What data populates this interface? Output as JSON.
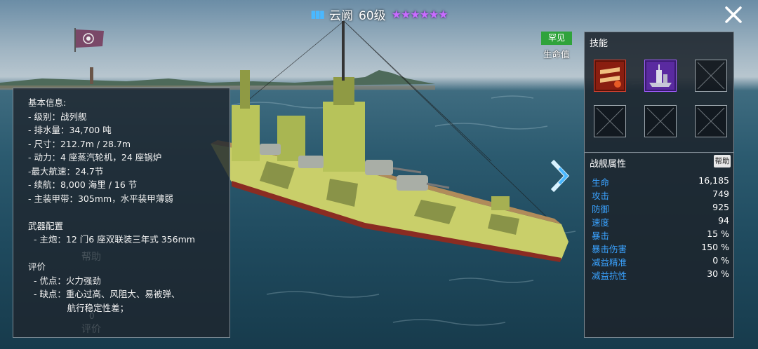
{
  "header": {
    "ammo_icon": "ammo-icon",
    "ship_name": "云阙",
    "level": "60级",
    "stars": 6,
    "star_color": "#c86cff"
  },
  "ship_info": {
    "lines": [
      "基本信息:",
      "- 级别：战列舰",
      "- 排水量：34,700 吨",
      "- 尺寸：212.7m / 28.7m",
      "- 动力：4 座蒸汽轮机，24 座锅炉",
      "-最大航速：24.7节",
      "- 续航：8,000 海里 / 16 节",
      "- 主装甲带：305mm，水平装甲薄弱",
      "",
      "武器配置",
      "  - 主炮：12 门6 座双联装三年式 356mm",
      "",
      "评价",
      "  - 优点：火力强劲",
      "  - 缺点：重心过高、风阻大、易被弹、",
      "              航行稳定性差；"
    ],
    "ghost_help": "帮助",
    "ghost_count": "0",
    "ghost_rating": "评价"
  },
  "rarity": {
    "label": "罕见",
    "color": "#2fa33b"
  },
  "hp_label": "生命值",
  "skills": {
    "title": "技能",
    "slots": [
      "torpedo-skill-icon",
      "ship-skill-icon",
      "empty",
      "empty",
      "empty",
      "empty"
    ]
  },
  "stats": {
    "title": "战舰属性",
    "help": "帮助",
    "rows": [
      {
        "name": "生命",
        "value": "16,185"
      },
      {
        "name": "攻击",
        "value": "749"
      },
      {
        "name": "防御",
        "value": "925"
      },
      {
        "name": "速度",
        "value": "94"
      },
      {
        "name": "暴击",
        "value": "15 %"
      },
      {
        "name": "暴击伤害",
        "value": "150 %"
      },
      {
        "name": "减益精准",
        "value": "0 %"
      },
      {
        "name": "减益抗性",
        "value": "30 %"
      }
    ]
  }
}
